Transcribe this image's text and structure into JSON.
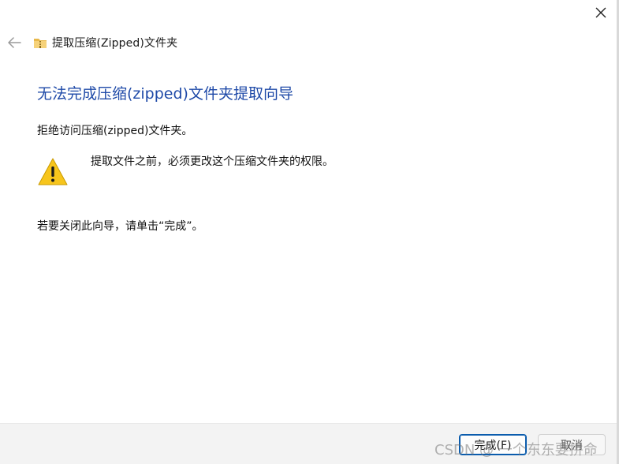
{
  "window": {
    "title": "提取压缩(Zipped)文件夹"
  },
  "content": {
    "heading": "无法完成压缩(zipped)文件夹提取向导",
    "message": "拒绝访问压缩(zipped)文件夹。",
    "warning_text": "提取文件之前，必须更改这个压缩文件夹的权限。",
    "instruction": "若要关闭此向导，请单击“完成”。"
  },
  "footer": {
    "finish_label": "完成(F)",
    "cancel_label": "取消"
  },
  "watermark": {
    "text": "CSDN @ 一个东东要拼命"
  },
  "icons": {
    "close": "close-icon",
    "back": "back-arrow-icon",
    "folder": "zip-folder-icon",
    "warning": "warning-icon"
  },
  "colors": {
    "heading": "#1f4aa8",
    "finish_border": "#0b5cad",
    "warning_fill": "#f7c51c",
    "footer_bg": "#f3f3f3"
  }
}
